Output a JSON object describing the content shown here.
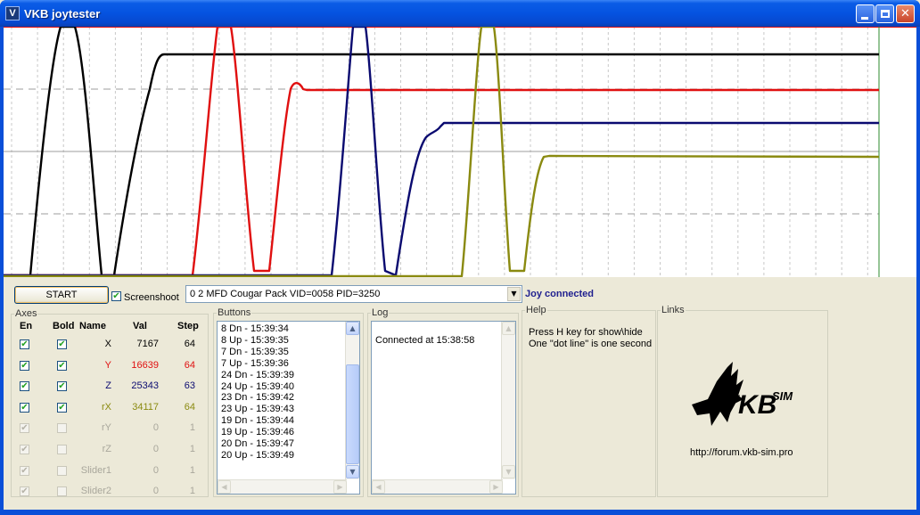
{
  "window": {
    "title": "VKB joytester",
    "app_icon_glyph": "V",
    "controls": {
      "minimize_icon": "minimize-icon",
      "maximize_icon": "maximize-icon",
      "close_icon": "close-icon",
      "close_glyph": "✕"
    }
  },
  "plot": {
    "background": "#ffffff",
    "grid_color": "#b0b0b0",
    "traces": [
      {
        "axis": "X",
        "color": "#000000"
      },
      {
        "axis": "Y",
        "color": "#e01010"
      },
      {
        "axis": "Z",
        "color": "#0a0a70"
      },
      {
        "axis": "rX",
        "color": "#8a8a10"
      }
    ]
  },
  "controls": {
    "start_label": "START",
    "screenshoot_label": "Screenshoot",
    "screenshoot_checked": true,
    "device_selected": "0 2 MFD Cougar Pack VID=0058 PID=3250",
    "status": "Joy connected",
    "combo_arrow": "▼"
  },
  "axes": {
    "group_title": "Axes",
    "headers": {
      "en": "En",
      "bold": "Bold",
      "name": "Name",
      "val": "Val",
      "step": "Step"
    },
    "rows": [
      {
        "name": "X",
        "val": "7167",
        "step": "64",
        "en": true,
        "bold": true,
        "enabled": true,
        "color": "#000000"
      },
      {
        "name": "Y",
        "val": "16639",
        "step": "64",
        "en": true,
        "bold": true,
        "enabled": true,
        "color": "#e01010"
      },
      {
        "name": "Z",
        "val": "25343",
        "step": "63",
        "en": true,
        "bold": true,
        "enabled": true,
        "color": "#0a0a70"
      },
      {
        "name": "rX",
        "val": "34117",
        "step": "64",
        "en": true,
        "bold": true,
        "enabled": true,
        "color": "#8a8a10"
      },
      {
        "name": "rY",
        "val": "0",
        "step": "1",
        "en": true,
        "bold": false,
        "enabled": false,
        "color": "#a9a79c"
      },
      {
        "name": "rZ",
        "val": "0",
        "step": "1",
        "en": true,
        "bold": false,
        "enabled": false,
        "color": "#a9a79c"
      },
      {
        "name": "Slider1",
        "val": "0",
        "step": "1",
        "en": true,
        "bold": false,
        "enabled": false,
        "color": "#a9a79c"
      },
      {
        "name": "Slider2",
        "val": "0",
        "step": "1",
        "en": true,
        "bold": false,
        "enabled": false,
        "color": "#a9a79c"
      }
    ]
  },
  "buttons_panel": {
    "title": "Buttons",
    "items": [
      "8 Dn - 15:39:34",
      "8 Up - 15:39:35",
      "7 Dn - 15:39:35",
      "7 Up - 15:39:36",
      "24 Dn - 15:39:39",
      "24 Up - 15:39:40",
      "23 Dn - 15:39:42",
      "23 Up - 15:39:43",
      "19 Dn - 15:39:44",
      "19 Up - 15:39:46",
      "20 Dn - 15:39:47",
      "20 Up - 15:39:49"
    ]
  },
  "log_panel": {
    "title": "Log",
    "text": "Connected at 15:38:58"
  },
  "help_panel": {
    "title": "Help",
    "lines": [
      "Press H key for show\\hide",
      "One \"dot line\" is one second"
    ]
  },
  "links_panel": {
    "title": "Links",
    "logo_text": "VKB",
    "logo_sup": "SIM",
    "url": "http://forum.vkb-sim.pro"
  },
  "scroll_glyphs": {
    "up": "▲",
    "down": "▼",
    "left": "◀",
    "right": "▶"
  }
}
